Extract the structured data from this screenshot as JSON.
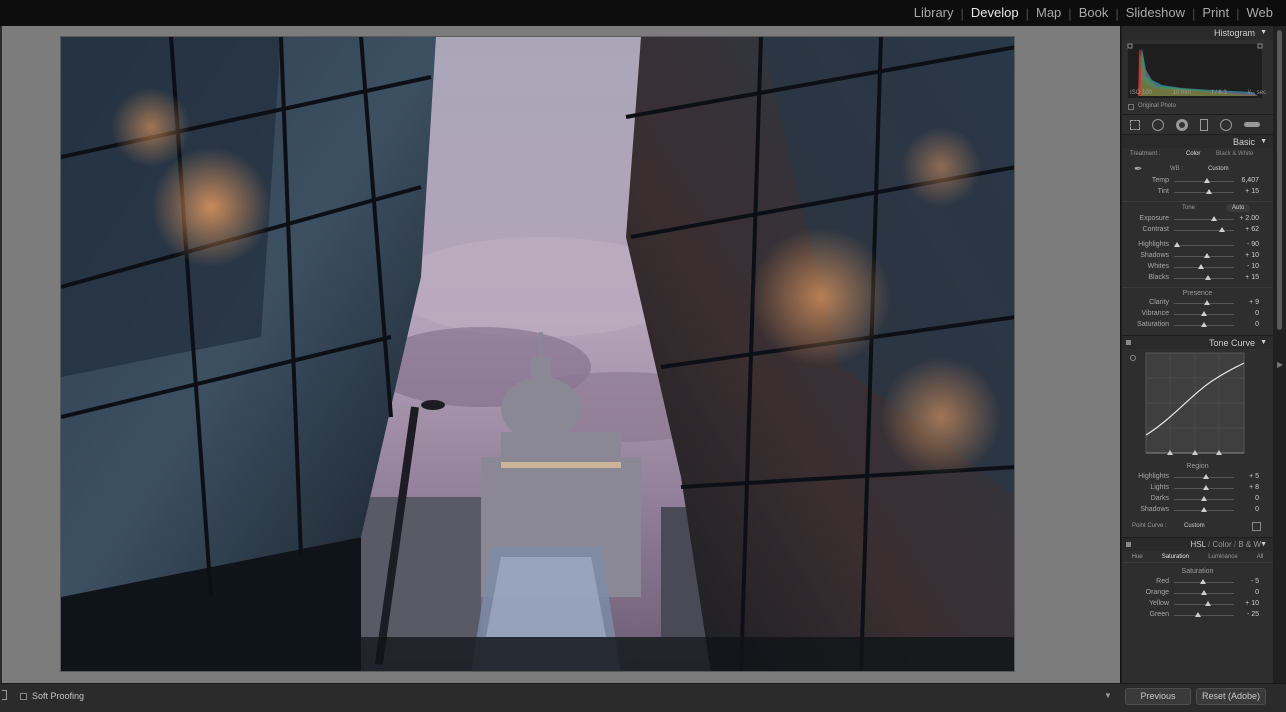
{
  "modules": [
    "Library",
    "Develop",
    "Map",
    "Book",
    "Slideshow",
    "Print",
    "Web"
  ],
  "active_module": "Develop",
  "histogram": {
    "title": "Histogram",
    "iso": "ISO 100",
    "focal": "10 mm",
    "aperture": "f / 6.3",
    "shutter": "¹⁄₁₀ sec",
    "original_photo_label": "Original Photo"
  },
  "basic": {
    "title": "Basic",
    "treatment_label": "Treatment :",
    "treatment_color": "Color",
    "treatment_bw": "Black & White",
    "wb_label": "WB :",
    "wb_value": "Custom",
    "tone_label": "Tone",
    "auto_label": "Auto",
    "presence_label": "Presence",
    "wb_sliders": [
      {
        "label": "Temp",
        "value": "6,407",
        "pos": 0.55
      },
      {
        "label": "Tint",
        "value": "+ 15",
        "pos": 0.58
      }
    ],
    "tone_sliders": [
      {
        "label": "Exposure",
        "value": "+ 2.00",
        "pos": 0.67
      },
      {
        "label": "Contrast",
        "value": "+ 62",
        "pos": 0.8
      }
    ],
    "tone_sliders2": [
      {
        "label": "Highlights",
        "value": "- 90",
        "pos": 0.05
      },
      {
        "label": "Shadows",
        "value": "+ 10",
        "pos": 0.55
      },
      {
        "label": "Whites",
        "value": "- 10",
        "pos": 0.45
      },
      {
        "label": "Blacks",
        "value": "+ 15",
        "pos": 0.57
      }
    ],
    "presence_sliders": [
      {
        "label": "Clarity",
        "value": "+ 9",
        "pos": 0.55
      },
      {
        "label": "Vibrance",
        "value": "0",
        "pos": 0.5
      },
      {
        "label": "Saturation",
        "value": "0",
        "pos": 0.5
      }
    ]
  },
  "tone_curve": {
    "title": "Tone Curve",
    "region_label": "Region",
    "sliders": [
      {
        "label": "Highlights",
        "value": "+ 5",
        "pos": 0.53
      },
      {
        "label": "Lights",
        "value": "+ 8",
        "pos": 0.54
      },
      {
        "label": "Darks",
        "value": "0",
        "pos": 0.5
      },
      {
        "label": "Shadows",
        "value": "0",
        "pos": 0.5
      }
    ],
    "point_curve_label": "Point Curve :",
    "point_curve_value": "Custom"
  },
  "hsl": {
    "title_hsl": "HSL",
    "title_color": "Color",
    "title_bw": "B & W",
    "tabs": [
      "Hue",
      "Saturation",
      "Luminance",
      "All"
    ],
    "active_tab": "Saturation",
    "section_label": "Saturation",
    "sliders": [
      {
        "label": "Red",
        "value": "- 5",
        "pos": 0.48
      },
      {
        "label": "Orange",
        "value": "0",
        "pos": 0.5
      },
      {
        "label": "Yellow",
        "value": "+ 10",
        "pos": 0.56
      },
      {
        "label": "Green",
        "value": "- 25",
        "pos": 0.4
      }
    ]
  },
  "bottom": {
    "soft_proofing": "Soft Proofing",
    "previous": "Previous",
    "reset": "Reset (Adobe)"
  },
  "colors": {
    "accent_text": "#e8e8e8",
    "panel_bg": "#2e2e2e",
    "canvas_bg": "#7c7c7c"
  }
}
